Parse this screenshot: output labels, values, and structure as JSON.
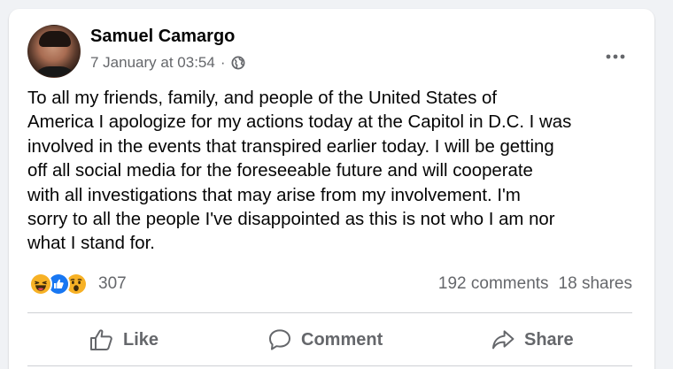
{
  "post": {
    "author": "Samuel Camargo",
    "timestamp": "7 January at 03:54",
    "separator": "·",
    "audience_icon": "globe-icon",
    "more_icon": "ellipsis-icon",
    "text": "To all my friends, family, and people of the United States of\nAmerica I apologize for my actions today at the Capitol in D.C. I was\ninvolved in the events that transpired earlier today. I will be getting\noff all social media for the foreseeable future and will cooperate\nwith all investigations that may arise from my involvement. I'm\nsorry to all the people I've disappointed as this is not who I am nor\nwhat I stand for."
  },
  "reactions": {
    "icons": [
      "haha-icon",
      "like-icon",
      "wow-icon"
    ],
    "count": "307"
  },
  "engagement": {
    "comments": "192 comments",
    "shares": "18 shares"
  },
  "actions": {
    "like": "Like",
    "comment": "Comment",
    "share": "Share"
  },
  "colors": {
    "background": "#f0f2f5",
    "card": "#ffffff",
    "text": "#050505",
    "secondary_text": "#65676b",
    "like_blue": "#1877f2",
    "reaction_yellow": "#f7b125"
  }
}
